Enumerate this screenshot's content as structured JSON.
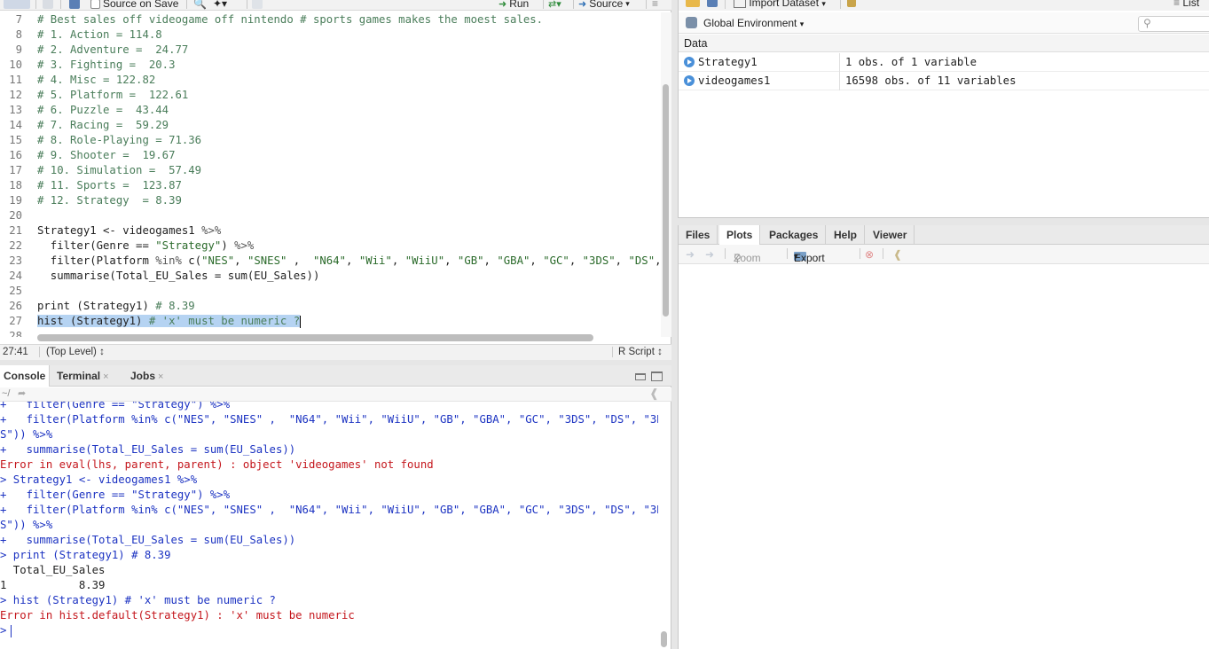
{
  "editor": {
    "toolbar": {
      "source_on_save": "Source on Save",
      "run": "Run",
      "source": "Source"
    },
    "lines": [
      {
        "n": "7",
        "segs": [
          {
            "t": "# Best sales off videogame off nintendo # sports games makes the moest sales.",
            "c": "cmt"
          }
        ]
      },
      {
        "n": "8",
        "segs": [
          {
            "t": "# 1. Action = 114.8",
            "c": "cmt"
          }
        ]
      },
      {
        "n": "9",
        "segs": [
          {
            "t": "# 2. Adventure =  24.77",
            "c": "cmt"
          }
        ]
      },
      {
        "n": "10",
        "segs": [
          {
            "t": "# 3. Fighting =  20.3",
            "c": "cmt"
          }
        ]
      },
      {
        "n": "11",
        "segs": [
          {
            "t": "# 4. Misc = 122.82",
            "c": "cmt"
          }
        ]
      },
      {
        "n": "12",
        "segs": [
          {
            "t": "# 5. Platform =  122.61",
            "c": "cmt"
          }
        ]
      },
      {
        "n": "13",
        "segs": [
          {
            "t": "# 6. Puzzle =  43.44",
            "c": "cmt"
          }
        ]
      },
      {
        "n": "14",
        "segs": [
          {
            "t": "# 7. Racing =  59.29",
            "c": "cmt"
          }
        ]
      },
      {
        "n": "15",
        "segs": [
          {
            "t": "# 8. Role-Playing = 71.36",
            "c": "cmt"
          }
        ]
      },
      {
        "n": "16",
        "segs": [
          {
            "t": "# 9. Shooter =  19.67",
            "c": "cmt"
          }
        ]
      },
      {
        "n": "17",
        "segs": [
          {
            "t": "# 10. Simulation =  57.49",
            "c": "cmt"
          }
        ]
      },
      {
        "n": "18",
        "segs": [
          {
            "t": "# 11. Sports =  123.87",
            "c": "cmt"
          }
        ]
      },
      {
        "n": "19",
        "segs": [
          {
            "t": "# 12. Strategy  = 8.39",
            "c": "cmt"
          }
        ]
      },
      {
        "n": "20",
        "segs": []
      },
      {
        "n": "21",
        "segs": [
          {
            "t": "Strategy1 <- videogames1 ",
            "c": ""
          },
          {
            "t": "%>%",
            "c": "op"
          }
        ]
      },
      {
        "n": "22",
        "segs": [
          {
            "t": "  filter(Genre == ",
            "c": ""
          },
          {
            "t": "\"Strategy\"",
            "c": "str"
          },
          {
            "t": ") ",
            "c": ""
          },
          {
            "t": "%>%",
            "c": "op"
          }
        ]
      },
      {
        "n": "23",
        "segs": [
          {
            "t": "  filter(Platform ",
            "c": ""
          },
          {
            "t": "%in%",
            "c": "op"
          },
          {
            "t": " c(",
            "c": ""
          },
          {
            "t": "\"NES\"",
            "c": "str"
          },
          {
            "t": ", ",
            "c": ""
          },
          {
            "t": "\"SNES\"",
            "c": "str"
          },
          {
            "t": " ,  ",
            "c": ""
          },
          {
            "t": "\"N64\"",
            "c": "str"
          },
          {
            "t": ", ",
            "c": ""
          },
          {
            "t": "\"Wii\"",
            "c": "str"
          },
          {
            "t": ", ",
            "c": ""
          },
          {
            "t": "\"WiiU\"",
            "c": "str"
          },
          {
            "t": ", ",
            "c": ""
          },
          {
            "t": "\"GB\"",
            "c": "str"
          },
          {
            "t": ", ",
            "c": ""
          },
          {
            "t": "\"GBA\"",
            "c": "str"
          },
          {
            "t": ", ",
            "c": ""
          },
          {
            "t": "\"GC\"",
            "c": "str"
          },
          {
            "t": ", ",
            "c": ""
          },
          {
            "t": "\"3DS\"",
            "c": "str"
          },
          {
            "t": ", ",
            "c": ""
          },
          {
            "t": "\"DS\"",
            "c": "str"
          },
          {
            "t": ", \"",
            "c": ""
          }
        ]
      },
      {
        "n": "24",
        "segs": [
          {
            "t": "  summarise(Total_EU_Sales = sum(EU_Sales))",
            "c": ""
          }
        ]
      },
      {
        "n": "25",
        "segs": []
      },
      {
        "n": "26",
        "segs": [
          {
            "t": "print (Strategy1) ",
            "c": ""
          },
          {
            "t": "# 8.39",
            "c": "cmt"
          }
        ]
      },
      {
        "n": "27",
        "segs": [
          {
            "t": "hist (Strategy1) ",
            "c": "sel"
          },
          {
            "t": "# 'x' must be numeric ?",
            "c": "cmt sel"
          }
        ]
      },
      {
        "n": "28",
        "segs": []
      }
    ],
    "status": {
      "position": "27:41",
      "scope": "(Top Level) ↕",
      "file_type": "R Script ↕"
    }
  },
  "console": {
    "tabs": {
      "console": "Console",
      "terminal": "Terminal",
      "jobs": "Jobs"
    },
    "path": "~/",
    "lines": [
      {
        "t": "+   filter(Genre == \"Strategy\") %>%",
        "c": "in"
      },
      {
        "t": "+   filter(Platform %in% c(\"NES\", \"SNES\" ,  \"N64\", \"Wii\", \"WiiU\", \"GB\", \"GBA\", \"GC\", \"3DS\", \"DS\", \"3D",
        "c": "in"
      },
      {
        "t": "S\")) %>%",
        "c": "in"
      },
      {
        "t": "+   summarise(Total_EU_Sales = sum(EU_Sales))",
        "c": "in"
      },
      {
        "t": "Error in eval(lhs, parent, parent) : object 'videogames' not found",
        "c": "err"
      },
      {
        "t": "> Strategy1 <- videogames1 %>%",
        "c": "in"
      },
      {
        "t": "+   filter(Genre == \"Strategy\") %>%",
        "c": "in"
      },
      {
        "t": "+   filter(Platform %in% c(\"NES\", \"SNES\" ,  \"N64\", \"Wii\", \"WiiU\", \"GB\", \"GBA\", \"GC\", \"3DS\", \"DS\", \"3D",
        "c": "in"
      },
      {
        "t": "S\")) %>%",
        "c": "in"
      },
      {
        "t": "+   summarise(Total_EU_Sales = sum(EU_Sales))",
        "c": "in"
      },
      {
        "t": "> print (Strategy1) # 8.39",
        "c": "in"
      },
      {
        "t": "  Total_EU_Sales",
        "c": "out"
      },
      {
        "t": "1           8.39",
        "c": "out"
      },
      {
        "t": "> hist (Strategy1) # 'x' must be numeric ?",
        "c": "in"
      },
      {
        "t": "Error in hist.default(Strategy1) : 'x' must be numeric",
        "c": "err"
      },
      {
        "t": "> ",
        "c": "in"
      }
    ]
  },
  "environment": {
    "toolbar": {
      "import_dataset": "Import Dataset",
      "list_view": "List"
    },
    "scope": "Global Environment",
    "section": "Data",
    "rows": [
      {
        "name": "Strategy1",
        "value": "1 obs. of 1 variable"
      },
      {
        "name": "videogames1",
        "value": "16598 obs. of 11 variables"
      }
    ]
  },
  "files_pane": {
    "tabs": [
      "Files",
      "Plots",
      "Packages",
      "Help",
      "Viewer"
    ],
    "active_tab": "Plots",
    "toolbar": {
      "zoom": "Zoom",
      "export": "Export"
    }
  }
}
